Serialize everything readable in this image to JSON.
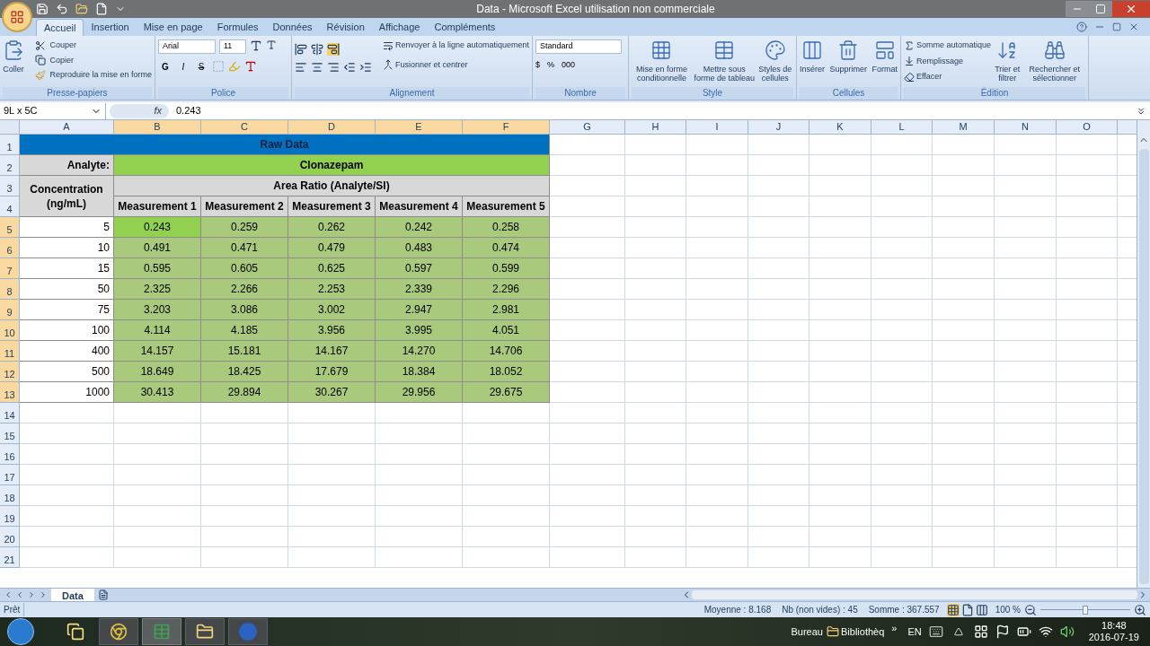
{
  "window": {
    "title": "Data - Microsoft Excel utilisation non commerciale"
  },
  "ribbon_tabs": [
    {
      "label": "Accueil",
      "selected": true
    },
    {
      "label": "Insertion",
      "selected": false
    },
    {
      "label": "Mise en page",
      "selected": false
    },
    {
      "label": "Formules",
      "selected": false
    },
    {
      "label": "Données",
      "selected": false
    },
    {
      "label": "Révision",
      "selected": false
    },
    {
      "label": "Affichage",
      "selected": false
    },
    {
      "label": "Compléments",
      "selected": false
    }
  ],
  "clipboard": {
    "name": "Presse-papiers",
    "paste": "Coller",
    "items": [
      "Couper",
      "Copier",
      "Reproduire la mise en forme"
    ]
  },
  "font": {
    "name": "Police",
    "family": "Arial",
    "size": "11",
    "styles": [
      "G",
      "I",
      "S"
    ]
  },
  "alignment": {
    "name": "Alignement",
    "wrap": "Renvoyer à la ligne automatiquement",
    "merge": "Fusionner et centrer"
  },
  "number": {
    "name": "Nombre",
    "format": "Standard",
    "buttons": [
      "$",
      "%",
      "000"
    ]
  },
  "style": {
    "name": "Style",
    "items": [
      "Mise en forme conditionnelle",
      "Mettre sous forme de tableau",
      "Styles de cellules"
    ]
  },
  "cells": {
    "name": "Cellules",
    "items": [
      "Insérer",
      "Supprimer",
      "Format"
    ]
  },
  "editing": {
    "name": "Édition",
    "small": [
      "Somme automatique",
      "Remplissage",
      "Effacer"
    ],
    "large": [
      "Trier et filtrer",
      "Rechercher et sélectionner"
    ]
  },
  "formula_bar": {
    "name_box": "9L x 5C",
    "function_label": "fx",
    "value": "0.243"
  },
  "sheet": {
    "columns": [
      {
        "label": "A",
        "selected": false
      },
      {
        "label": "B",
        "selected": true
      },
      {
        "label": "C",
        "selected": true
      },
      {
        "label": "D",
        "selected": true
      },
      {
        "label": "E",
        "selected": true
      },
      {
        "label": "F",
        "selected": true
      },
      {
        "label": "G",
        "selected": false
      },
      {
        "label": "H",
        "selected": false
      },
      {
        "label": "I",
        "selected": false
      },
      {
        "label": "J",
        "selected": false
      },
      {
        "label": "K",
        "selected": false
      },
      {
        "label": "L",
        "selected": false
      },
      {
        "label": "M",
        "selected": false
      },
      {
        "label": "N",
        "selected": false
      },
      {
        "label": "O",
        "selected": false
      }
    ],
    "header_rows": [
      "1",
      "2",
      "3",
      "4"
    ],
    "title": "Raw Data",
    "analyte_label": "Analyte:",
    "analyte": "Clonazepam",
    "concentration_label": "Concentration (ng/mL)",
    "ratio_label": "Area Ratio (Analyte/SI)",
    "measurements": [
      "Measurement 1",
      "Measurement 2",
      "Measurement 3",
      "Measurement 4",
      "Measurement 5"
    ],
    "data_rows": [
      {
        "label": "5",
        "selected": true,
        "concentration": "5",
        "values": [
          {
            "text": "0.243",
            "active": true
          },
          {
            "text": "0.259",
            "active": false
          },
          {
            "text": "0.262",
            "active": false
          },
          {
            "text": "0.242",
            "active": false
          },
          {
            "text": "0.258",
            "active": false
          }
        ]
      },
      {
        "label": "6",
        "selected": true,
        "concentration": "10",
        "values": [
          {
            "text": "0.491",
            "active": false
          },
          {
            "text": "0.471",
            "active": false
          },
          {
            "text": "0.479",
            "active": false
          },
          {
            "text": "0.483",
            "active": false
          },
          {
            "text": "0.474",
            "active": false
          }
        ]
      },
      {
        "label": "7",
        "selected": true,
        "concentration": "15",
        "values": [
          {
            "text": "0.595",
            "active": false
          },
          {
            "text": "0.605",
            "active": false
          },
          {
            "text": "0.625",
            "active": false
          },
          {
            "text": "0.597",
            "active": false
          },
          {
            "text": "0.599",
            "active": false
          }
        ]
      },
      {
        "label": "8",
        "selected": true,
        "concentration": "50",
        "values": [
          {
            "text": "2.325",
            "active": false
          },
          {
            "text": "2.266",
            "active": false
          },
          {
            "text": "2.253",
            "active": false
          },
          {
            "text": "2.339",
            "active": false
          },
          {
            "text": "2.296",
            "active": false
          }
        ]
      },
      {
        "label": "9",
        "selected": true,
        "concentration": "75",
        "values": [
          {
            "text": "3.203",
            "active": false
          },
          {
            "text": "3.086",
            "active": false
          },
          {
            "text": "3.002",
            "active": false
          },
          {
            "text": "2.947",
            "active": false
          },
          {
            "text": "2.981",
            "active": false
          }
        ]
      },
      {
        "label": "10",
        "selected": true,
        "concentration": "100",
        "values": [
          {
            "text": "4.114",
            "active": false
          },
          {
            "text": "4.185",
            "active": false
          },
          {
            "text": "3.956",
            "active": false
          },
          {
            "text": "3.995",
            "active": false
          },
          {
            "text": "4.051",
            "active": false
          }
        ]
      },
      {
        "label": "11",
        "selected": true,
        "concentration": "400",
        "values": [
          {
            "text": "14.157",
            "active": false
          },
          {
            "text": "15.181",
            "active": false
          },
          {
            "text": "14.167",
            "active": false
          },
          {
            "text": "14.270",
            "active": false
          },
          {
            "text": "14.706",
            "active": false
          }
        ]
      },
      {
        "label": "12",
        "selected": true,
        "concentration": "500",
        "values": [
          {
            "text": "18.649",
            "active": false
          },
          {
            "text": "18.425",
            "active": false
          },
          {
            "text": "17.679",
            "active": false
          },
          {
            "text": "18.384",
            "active": false
          },
          {
            "text": "18.052",
            "active": false
          }
        ]
      },
      {
        "label": "13",
        "selected": true,
        "concentration": "1000",
        "values": [
          {
            "text": "30.413",
            "active": false
          },
          {
            "text": "29.894",
            "active": false
          },
          {
            "text": "30.267",
            "active": false
          },
          {
            "text": "29.956",
            "active": false
          },
          {
            "text": "29.675",
            "active": false
          }
        ]
      }
    ],
    "empty_rows": [
      "14",
      "15",
      "16",
      "17",
      "18",
      "19",
      "20",
      "21"
    ]
  },
  "sheet_tabs": [
    {
      "label": "Data",
      "selected": true
    }
  ],
  "status_bar": {
    "mode": "Prêt",
    "average": "Moyenne : 8.168",
    "count": "Nb (non vides) : 45",
    "sum": "Somme : 367.557",
    "zoom": "100 %",
    "zoom_level": {
      "level": 0.5
    }
  },
  "taskbar": {
    "toolbars": [
      "Bureau",
      "Bibliothèq"
    ],
    "more": "»",
    "language": "EN",
    "time": "18:48",
    "date": "2016-07-19"
  }
}
